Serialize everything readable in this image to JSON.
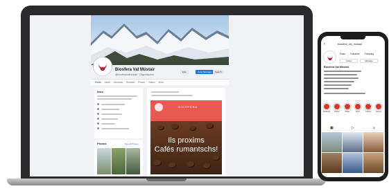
{
  "laptop": {
    "page_name": "Biosfera Val Müstair",
    "page_subtitle": "@biosferavalmustair · Organisaziun",
    "buttons": {
      "like": "Like",
      "message": "Send Message",
      "search": "Search"
    },
    "tabs": [
      "Posts",
      "About",
      "Mentions",
      "Reviews",
      "Photos",
      "Videos",
      "More"
    ],
    "intro_title": "Intro",
    "post_brand": "BIOSFERA",
    "post_headline_1": "Ils proxims",
    "post_headline_2": "Cafés rumantschs!",
    "photos_title": "Photos",
    "photos_see_all": "See All Photos"
  },
  "phone": {
    "username": "biosfera_val_müstair",
    "stats": [
      {
        "value": "",
        "label": "Posts"
      },
      {
        "value": "",
        "label": "Followers"
      },
      {
        "value": "",
        "label": "Following"
      }
    ],
    "follow_label": "Follow",
    "message_label": "Message",
    "bio_name": "Biosfera Val Müstair",
    "highlights": [
      "Sustanza",
      "Natura",
      "Pässe",
      "Sport",
      "Cultura",
      "Events"
    ],
    "tab_labels": [
      "",
      "",
      ""
    ],
    "colors": {
      "highlight_ring": "#d9352b",
      "facebook_blue": "#1b74e4"
    }
  }
}
